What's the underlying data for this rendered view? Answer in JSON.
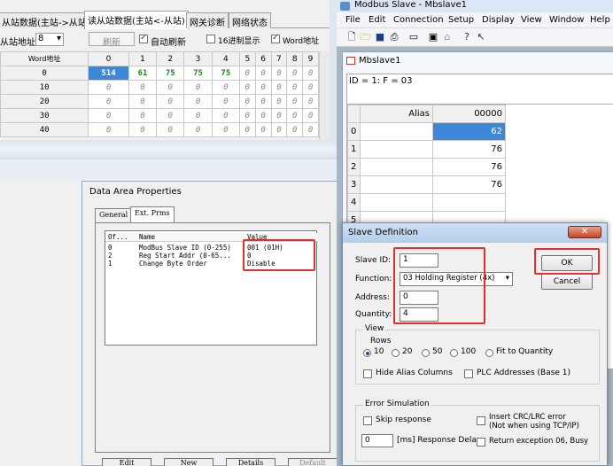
{
  "left_app": {
    "tabs": [
      "从站数据(主站->从站)",
      "读从站数据(主站<-从站)",
      "网关诊断",
      "网络状态"
    ],
    "slave_addr_label": "从站地址",
    "slave_addr_value": "8",
    "refresh_label": "刷新",
    "auto_refresh_label": "自动刷新",
    "hex_label": "16进制显示",
    "word_addr_label": "Word地址",
    "grid": {
      "corner": "Word地址",
      "columns": [
        "0",
        "1",
        "2",
        "3",
        "4",
        "5",
        "6",
        "7",
        "8",
        "9"
      ],
      "rows": [
        {
          "head": "0",
          "cells": [
            "514",
            "61",
            "75",
            "75",
            "75",
            "0",
            "0",
            "0",
            "0",
            "0"
          ]
        },
        {
          "head": "10",
          "cells": [
            "0",
            "0",
            "0",
            "0",
            "0",
            "0",
            "0",
            "0",
            "0",
            "0"
          ]
        },
        {
          "head": "20",
          "cells": [
            "0",
            "0",
            "0",
            "0",
            "0",
            "0",
            "0",
            "0",
            "0",
            "0"
          ]
        },
        {
          "head": "30",
          "cells": [
            "0",
            "0",
            "0",
            "0",
            "0",
            "0",
            "0",
            "0",
            "0",
            "0"
          ]
        },
        {
          "head": "40",
          "cells": [
            "0",
            "0",
            "0",
            "0",
            "0",
            "0",
            "0",
            "0",
            "0",
            "0"
          ]
        }
      ]
    }
  },
  "data_area": {
    "title": "Data Area Properties",
    "tabs": [
      "General",
      "Ext. Prms"
    ],
    "list_headers": [
      "Of...",
      "Name",
      "Value"
    ],
    "rows": [
      {
        "off": "0",
        "name": "ModBus Slave ID (0-255)",
        "value": "001 (01H)"
      },
      {
        "off": "2",
        "name": "Reg Start Addr (0-65...",
        "value": "0"
      },
      {
        "off": "1",
        "name": "Change Byte Order",
        "value": "Disable"
      }
    ],
    "buttons": [
      "Edit",
      "New",
      "Details",
      "Default"
    ]
  },
  "modbus_slave": {
    "title": "Modbus Slave - Mbslave1",
    "menus": [
      "File",
      "Edit",
      "Connection",
      "Setup",
      "Display",
      "View",
      "Window",
      "Help"
    ],
    "child_title": "Mbslave1",
    "id_line": "ID = 1: F = 03",
    "col_alias": "Alias",
    "col_addr": "00000",
    "rows": [
      {
        "n": "0",
        "v": "62"
      },
      {
        "n": "1",
        "v": "76"
      },
      {
        "n": "2",
        "v": "76"
      },
      {
        "n": "3",
        "v": "76"
      },
      {
        "n": "4",
        "v": ""
      },
      {
        "n": "5",
        "v": ""
      }
    ]
  },
  "slave_def": {
    "title": "Slave Definition",
    "slave_id_label": "Slave ID:",
    "slave_id_value": "1",
    "function_label": "Function:",
    "function_value": "03 Holding Register (4x)",
    "address_label": "Address:",
    "address_value": "0",
    "quantity_label": "Quantity:",
    "quantity_value": "4",
    "ok_label": "OK",
    "cancel_label": "Cancel",
    "view_label": "View",
    "rows_label": "Rows",
    "row_options": [
      "10",
      "20",
      "50",
      "100",
      "Fit to Quantity"
    ],
    "hide_alias_label": "Hide Alias Columns",
    "plc_addr_label": "PLC Addresses (Base 1)",
    "error_sim_label": "Error Simulation",
    "skip_response_label": "Skip response",
    "crc_label_1": "Insert CRC/LRC error",
    "crc_label_2": "(Not when using TCP/IP)",
    "delay_value": "0",
    "delay_label": "[ms] Response Delay",
    "exception_label": "Return exception 06, Busy"
  },
  "colors": {
    "highlight": "#e03030",
    "selection": "#3d87d9",
    "value_green": "#1a8a1a"
  }
}
